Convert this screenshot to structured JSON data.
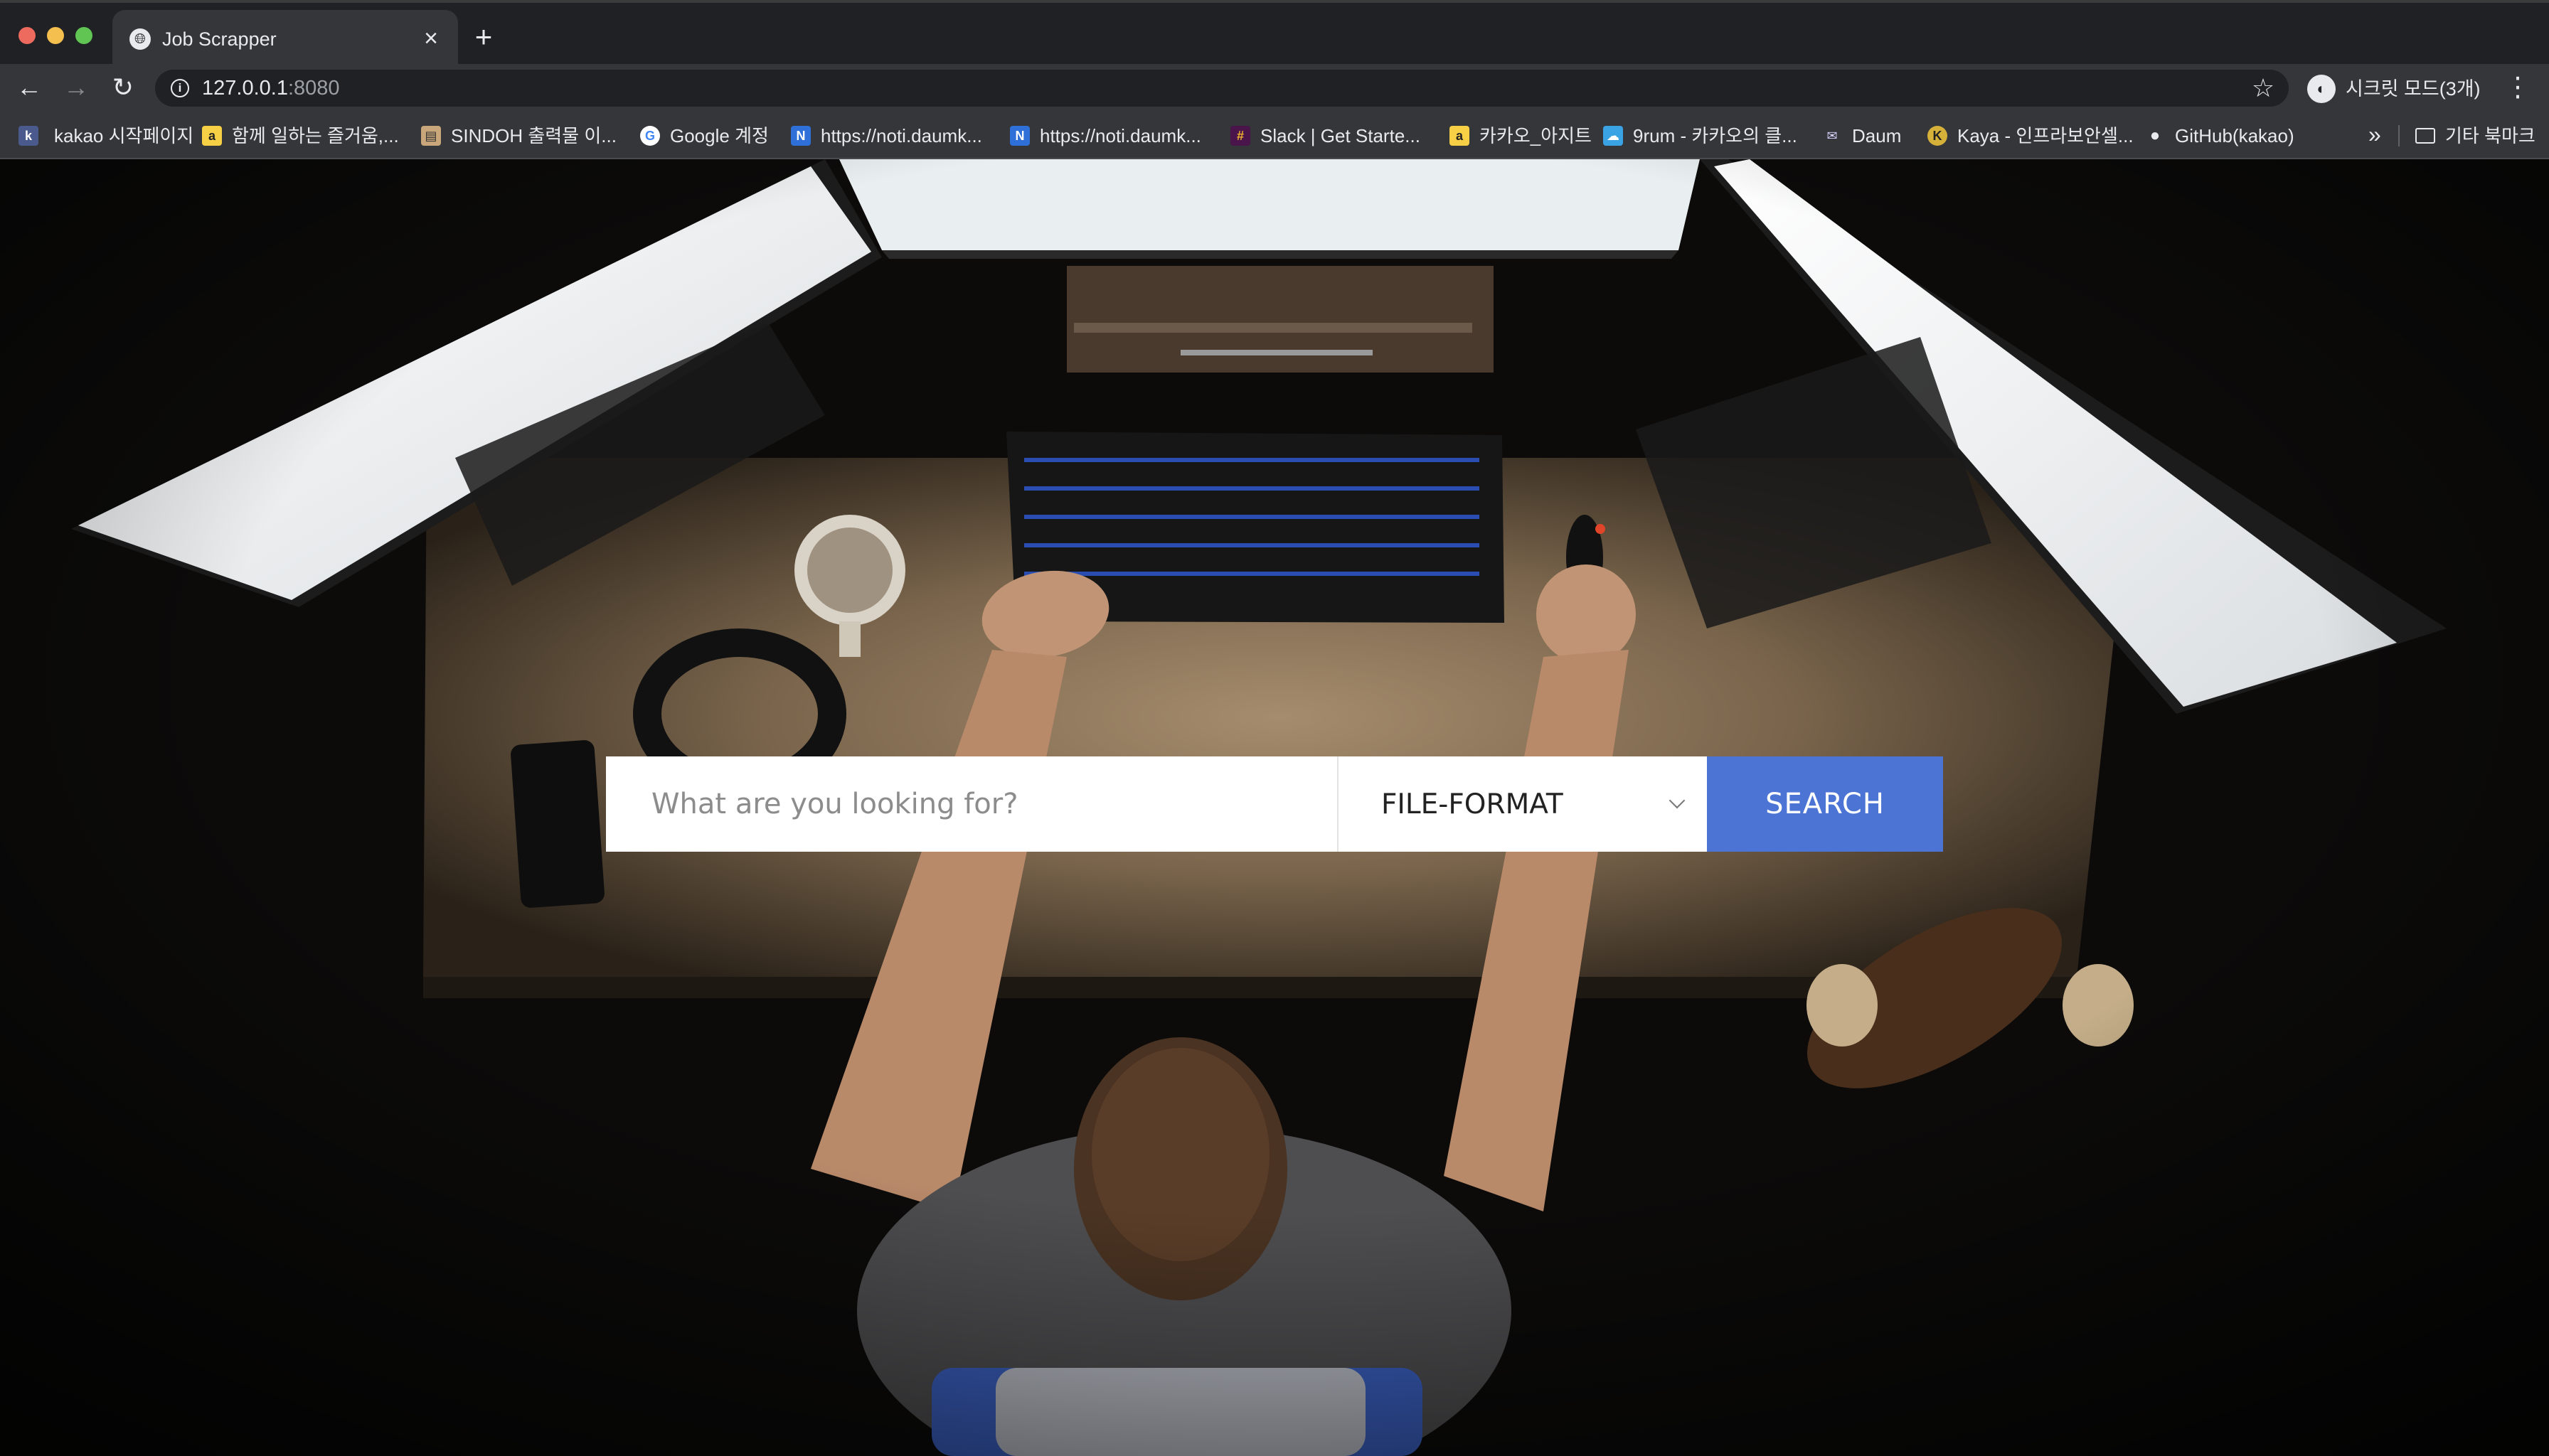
{
  "browser": {
    "tab": {
      "title": "Job Scrapper",
      "close_glyph": "×"
    },
    "new_tab_glyph": "+",
    "nav": {
      "back_glyph": "←",
      "forward_glyph": "→",
      "reload_glyph": "↻"
    },
    "address": {
      "host": "127.0.0.1",
      "port": ":8080",
      "info_glyph": "i"
    },
    "star_glyph": "☆",
    "incognito_label": "시크릿 모드(3개)",
    "menu_glyph": "⋮",
    "bookmarks": [
      {
        "label": "kakao 시작페이지",
        "icon": "kakao-k-icon",
        "glyph": "k"
      },
      {
        "label": "함께 일하는 즐거움,...",
        "icon": "agit-icon",
        "glyph": "a"
      },
      {
        "label": "SINDOH 출력물 이...",
        "icon": "sindoh-icon",
        "glyph": "▤"
      },
      {
        "label": "Google 계정",
        "icon": "google-icon",
        "glyph": "G"
      },
      {
        "label": "https://noti.daumk...",
        "icon": "noti-icon",
        "glyph": "N"
      },
      {
        "label": "https://noti.daumk...",
        "icon": "noti-icon",
        "glyph": "N"
      },
      {
        "label": "Slack | Get Starte...",
        "icon": "slack-icon",
        "glyph": "#"
      },
      {
        "label": "카카오_아지트",
        "icon": "agit-icon",
        "glyph": "a"
      },
      {
        "label": "9rum - 카카오의 클...",
        "icon": "9rum-cloud-icon",
        "glyph": "☁"
      },
      {
        "label": "Daum",
        "icon": "daum-mail-icon",
        "glyph": "✉"
      },
      {
        "label": "Kaya - 인프라보안셀...",
        "icon": "kaya-icon",
        "glyph": "K"
      },
      {
        "label": "GitHub(kakao)",
        "icon": "github-icon",
        "glyph": "●"
      }
    ],
    "bookmarks_more_glyph": "»",
    "other_bookmarks_label": "기타 북마크"
  },
  "search": {
    "placeholder": "What are you looking for?",
    "format_label": "FILE-FORMAT",
    "button_label": "SEARCH"
  },
  "colors": {
    "accent": "#4b74d4",
    "chrome_dark": "#202124",
    "chrome_toolbar": "#35363a"
  }
}
